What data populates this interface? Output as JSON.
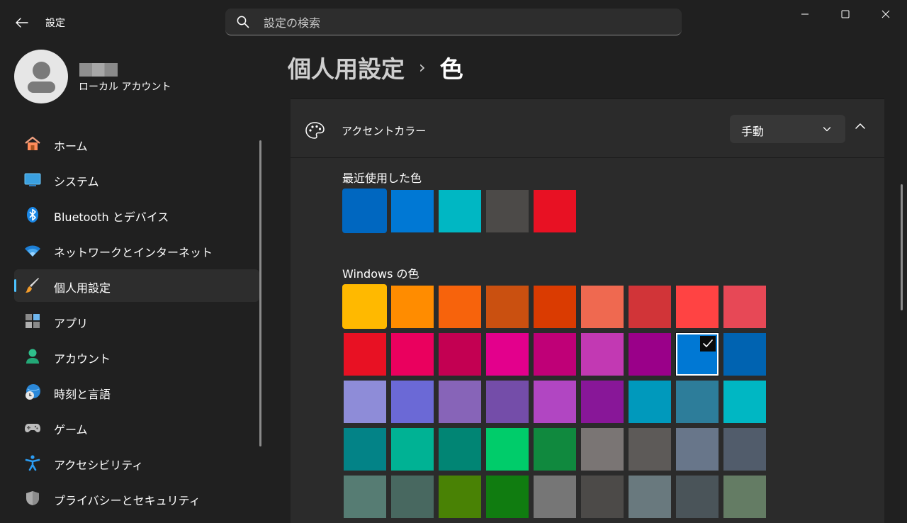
{
  "window": {
    "app_title": "設定",
    "search_placeholder": "設定の検索"
  },
  "user": {
    "account_type": "ローカル アカウント"
  },
  "nav": {
    "items": [
      {
        "label": "ホーム",
        "icon": "home-icon"
      },
      {
        "label": "システム",
        "icon": "system-icon"
      },
      {
        "label": "Bluetooth とデバイス",
        "icon": "bluetooth-icon"
      },
      {
        "label": "ネットワークとインターネット",
        "icon": "wifi-icon"
      },
      {
        "label": "個人用設定",
        "icon": "brush-icon",
        "selected": true
      },
      {
        "label": "アプリ",
        "icon": "apps-icon"
      },
      {
        "label": "アカウント",
        "icon": "account-icon"
      },
      {
        "label": "時刻と言語",
        "icon": "time-language-icon"
      },
      {
        "label": "ゲーム",
        "icon": "gamepad-icon"
      },
      {
        "label": "アクセシビリティ",
        "icon": "accessibility-icon"
      },
      {
        "label": "プライバシーとセキュリティ",
        "icon": "shield-icon"
      }
    ]
  },
  "breadcrumb": {
    "parent": "個人用設定",
    "separator": "›",
    "current": "色"
  },
  "accent": {
    "label": "アクセントカラー",
    "mode_value": "手動",
    "recent_label": "最近使用した色",
    "recent_colors": [
      "#0067c0",
      "#0078d4",
      "#00b7c3",
      "#4c4a48",
      "#e81123"
    ],
    "windows_label": "Windows の色",
    "windows_colors": [
      [
        "#ffb900",
        "#ff8c00",
        "#f7630c",
        "#ca5010",
        "#da3b01",
        "#ef6950",
        "#d13438",
        "#ff4343",
        "#e74856"
      ],
      [
        "#e81123",
        "#ea005e",
        "#c30052",
        "#e3008c",
        "#bf0077",
        "#c239b3",
        "#9a0089",
        "#0078d4",
        "#0063b1"
      ],
      [
        "#8e8cd8",
        "#6b69d6",
        "#8764b8",
        "#744da9",
        "#b146c2",
        "#881798",
        "#0099bc",
        "#2d7d9a",
        "#00b7c3"
      ],
      [
        "#038387",
        "#00b294",
        "#018574",
        "#00cc6a",
        "#10893e",
        "#7a7574",
        "#5d5a58",
        "#68768a",
        "#515c6b"
      ],
      [
        "#567c73",
        "#486860",
        "#498205",
        "#107c10",
        "#767676",
        "#4c4a48",
        "#69797e",
        "#4a5459",
        "#647c64"
      ]
    ],
    "selected_color": "#0078d4"
  }
}
